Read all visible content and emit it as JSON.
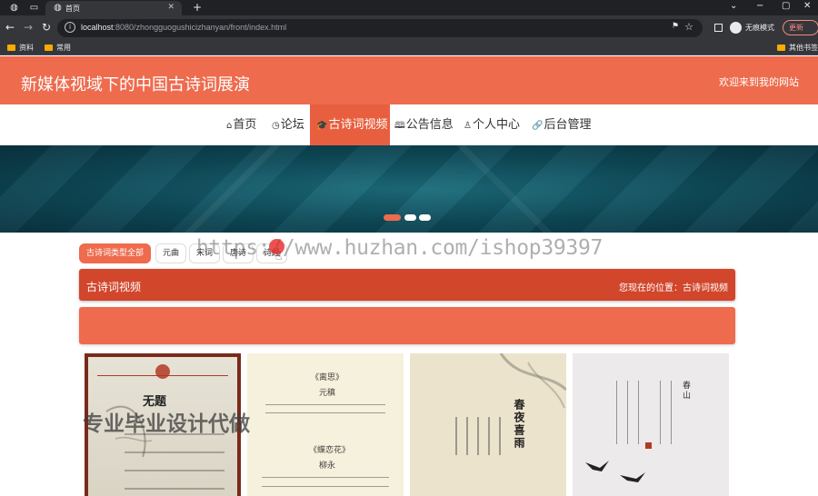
{
  "browser": {
    "tab_title": "首页",
    "url_host": "localhost",
    "url_rest": ":8080/zhongguogushicizhanyan/front/index.html",
    "profile_label": "无痕模式",
    "update_label": "更新",
    "bookmarks": [
      "资料",
      "常用",
      "其他书签"
    ]
  },
  "header": {
    "site_title": "新媒体视域下的中国古诗词展演",
    "welcome": "欢迎来到我的网站"
  },
  "nav": {
    "items": [
      {
        "label": "首页",
        "icon": "home-icon",
        "glyph": "⌂"
      },
      {
        "label": "论坛",
        "icon": "clock-icon",
        "glyph": "◷"
      },
      {
        "label": "古诗词视频",
        "icon": "graduation-icon",
        "glyph": "🎓"
      },
      {
        "label": "公告信息",
        "icon": "book-icon",
        "glyph": "🕮"
      },
      {
        "label": "个人中心",
        "icon": "user-icon",
        "glyph": "♙"
      },
      {
        "label": "后台管理",
        "icon": "link-icon",
        "glyph": "🔗"
      }
    ],
    "active_index": 2
  },
  "banner": {
    "slides": 3,
    "active_slide": 0
  },
  "filters": [
    "古诗词类型全部",
    "元曲",
    "宋词",
    "唐诗",
    "诗经"
  ],
  "watermarks": {
    "url": "https://www.huzhan.com/ishop39397",
    "text": "专业毕业设计代做"
  },
  "section": {
    "title": "古诗词视频",
    "location_prefix": "您现在的位置：",
    "location": "古诗词视频"
  },
  "cards": {
    "card1": {
      "title": "无题"
    },
    "card2": {
      "title": "《离思》",
      "author": "元稹",
      "subtitle": "《蝶恋花》",
      "subauthor": "柳永"
    },
    "card3": {
      "title": "春夜喜雨"
    },
    "card4": {
      "title": "春山"
    }
  },
  "colors": {
    "header": "#ee6b4d",
    "nav_active": "#e85f3f",
    "section_bar": "#d2462c"
  }
}
